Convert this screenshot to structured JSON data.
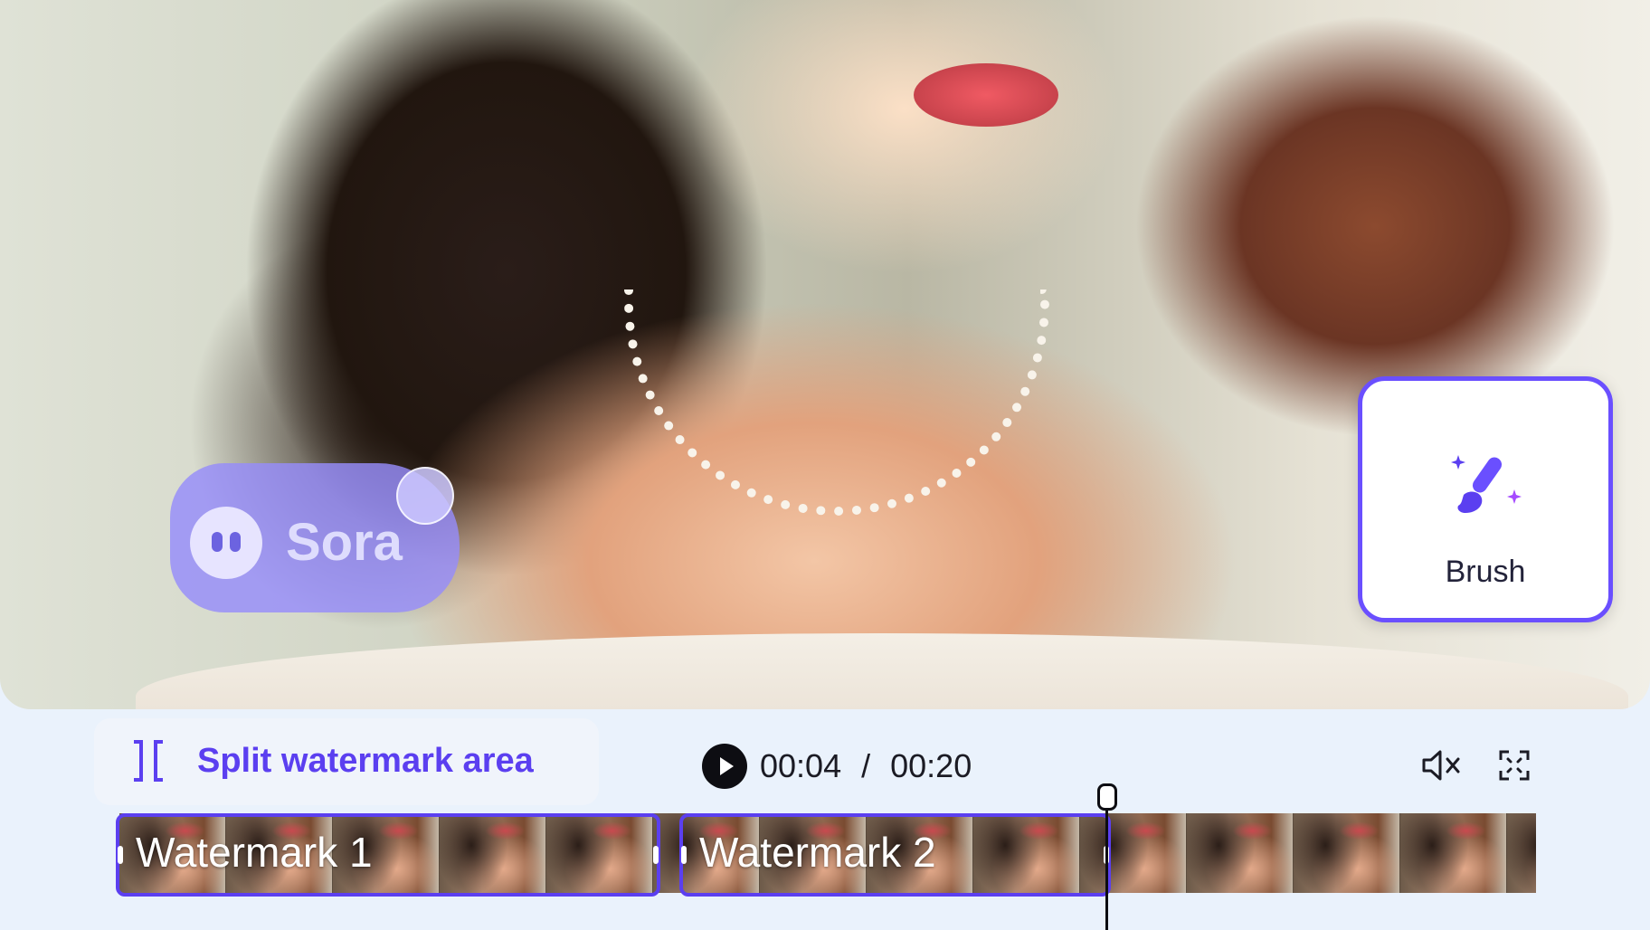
{
  "watermark_overlay": {
    "text": "Sora"
  },
  "tool_card": {
    "label": "Brush"
  },
  "split_button": {
    "label": "Split watermark area"
  },
  "playback": {
    "current_time": "00:04",
    "separator": "/",
    "total_time": "00:20"
  },
  "timeline": {
    "segments": [
      {
        "label": "Watermark 1"
      },
      {
        "label": "Watermark 2"
      }
    ]
  },
  "colors": {
    "accent": "#5b3ff0",
    "card_border": "#6a4fff",
    "panel_bg": "#eaf2fc"
  },
  "icons": {
    "brush": "brush-sparkle-icon",
    "split": "split-bracket-icon",
    "play": "play-icon",
    "mute": "volume-mute-icon",
    "fullscreen": "fullscreen-icon"
  }
}
